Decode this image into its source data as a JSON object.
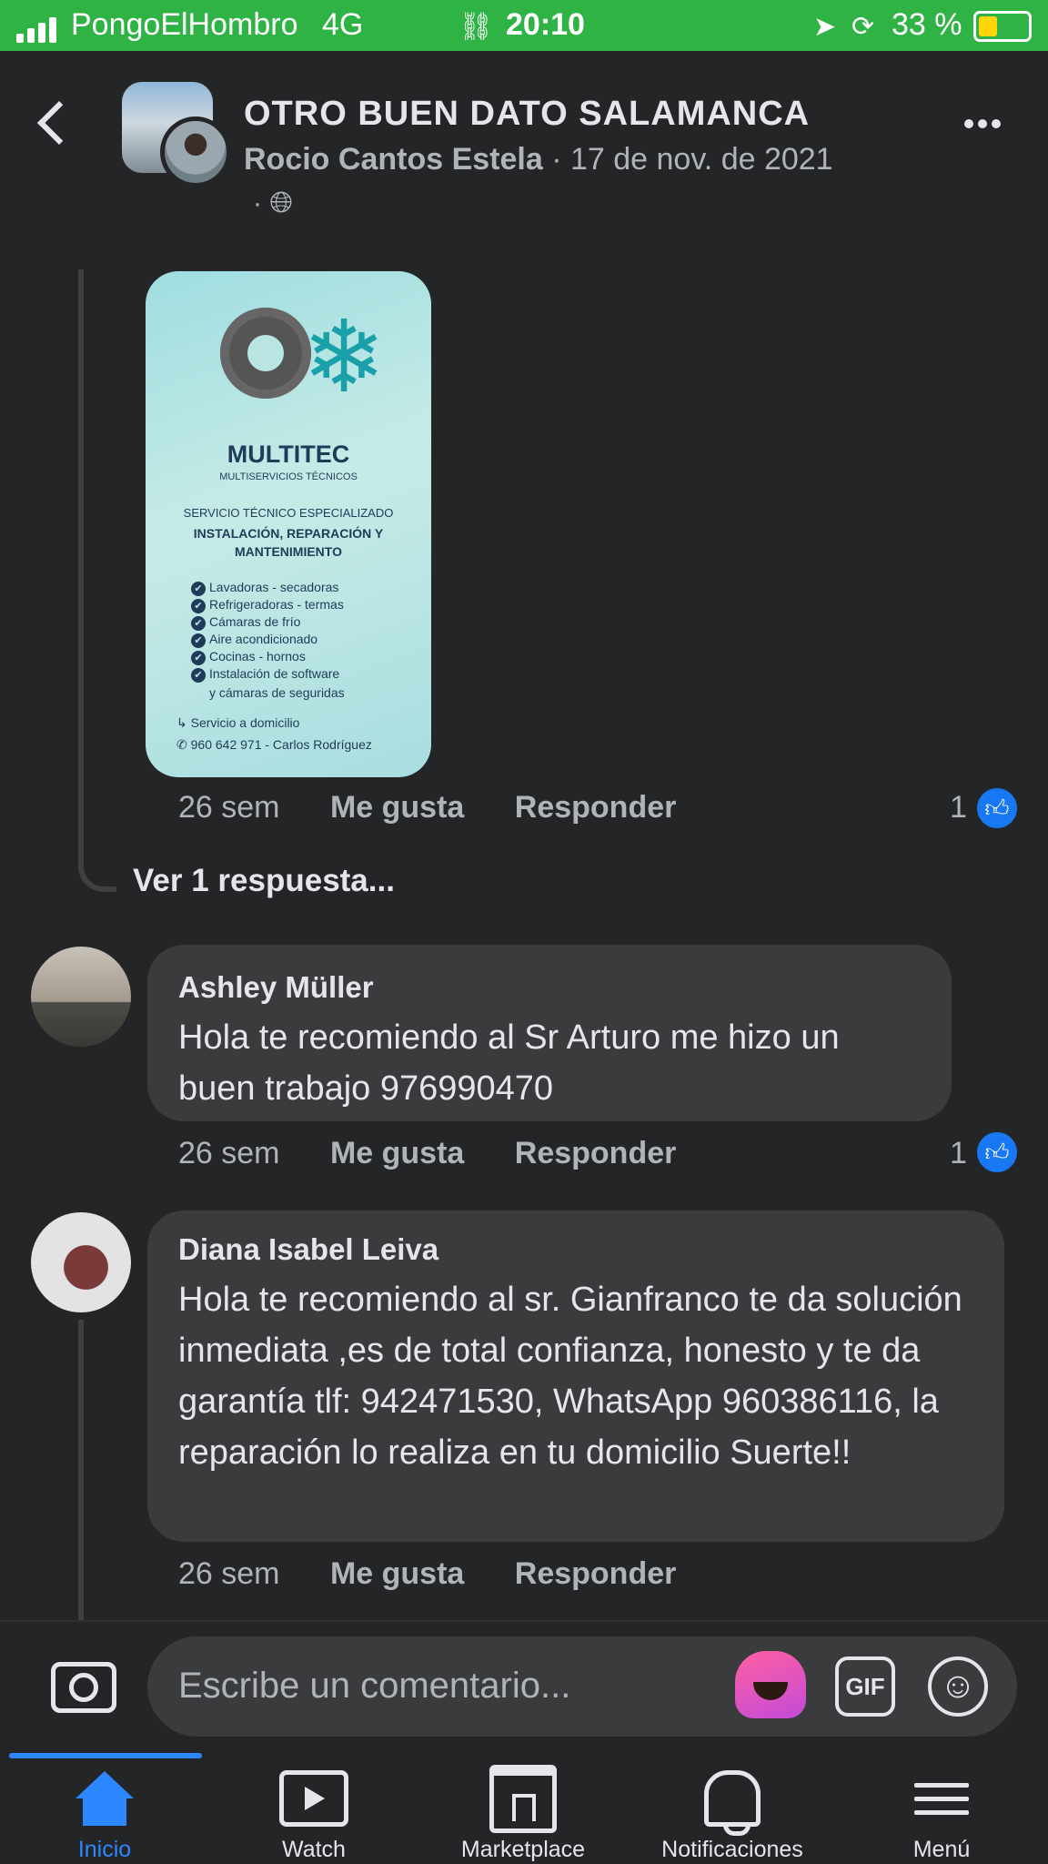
{
  "status_bar": {
    "carrier": "PongoElHombro",
    "network": "4G",
    "time": "20:10",
    "battery": "33 %"
  },
  "header": {
    "group_name": "OTRO BUEN DATO SALAMANCA",
    "author": "Rocio Cantos Estela",
    "date": "· 17 de nov. de 2021",
    "privacy_separator": "·"
  },
  "image_card": {
    "brand": "MULTITEC",
    "brand_sub": "MULTISERVICIOS TÉCNICOS",
    "service_line1": "SERVICIO TÉCNICO ESPECIALIZADO",
    "service_line2": "INSTALACIÓN, REPARACIÓN Y MANTENIMIENTO",
    "items": [
      "Lavadoras - secadoras",
      "Refrigeradoras - termas",
      "Cámaras de frío",
      "Aire acondicionado",
      "Cocinas - hornos",
      "Instalación de software"
    ],
    "item_cont": "y cámaras de seguridas",
    "footer1": "Servicio a domicilio",
    "footer2": "960 642 971 - Carlos Rodríguez"
  },
  "comment0": {
    "time": "26 sem",
    "like": "Me gusta",
    "reply": "Responder",
    "likes": "1"
  },
  "view_replies": "Ver 1 respuesta...",
  "comment1": {
    "name": "Ashley Müller",
    "text": "Hola te recomiendo al Sr Arturo me hizo un buen trabajo 976990470",
    "time": "26 sem",
    "like": "Me gusta",
    "reply": "Responder",
    "likes": "1"
  },
  "comment2": {
    "name": "Diana Isabel Leiva",
    "text": "Hola te recomiendo al sr. Gianfranco te da solución inmediata ,es de total confianza, honesto y te da garantía tlf: 942471530, WhatsApp 960386116, la reparación lo realiza en tu domicilio Suerte!!",
    "time": "26 sem",
    "like": "Me gusta",
    "reply": "Responder"
  },
  "composer": {
    "placeholder": "Escribe un comentario...",
    "gif": "GIF"
  },
  "nav": {
    "home": "Inicio",
    "watch": "Watch",
    "marketplace": "Marketplace",
    "notifications": "Notificaciones",
    "menu": "Menú"
  },
  "colors": {
    "status_bar": "#2fb344",
    "background": "#242527",
    "bubble": "#3a3b3c",
    "accent": "#2d88ff",
    "like_badge": "#1877f2"
  },
  "icons": [
    "signal-icon",
    "link-icon",
    "location-icon",
    "rotation-lock-icon",
    "battery-icon",
    "back-icon",
    "globe-icon",
    "more-icon",
    "like-icon",
    "camera-icon",
    "avatar-sticker-icon",
    "gif-icon",
    "emoji-icon",
    "home-icon",
    "watch-icon",
    "marketplace-icon",
    "bell-icon",
    "menu-icon"
  ]
}
